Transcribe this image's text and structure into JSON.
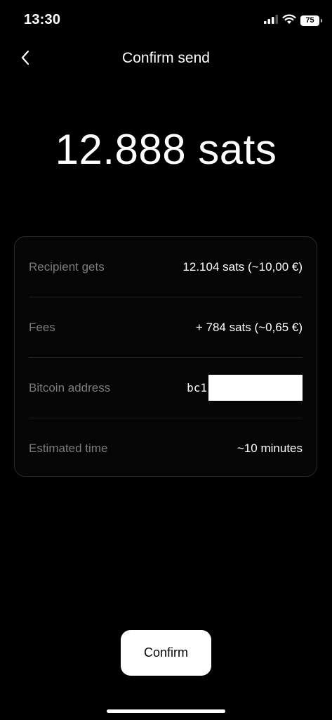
{
  "status_bar": {
    "time": "13:30",
    "battery": "75",
    "icons": [
      "cellular-signal-icon",
      "wifi-icon",
      "battery-icon"
    ]
  },
  "header": {
    "title": "Confirm send",
    "back_icon": "chevron-left-icon"
  },
  "amount": {
    "text": "12.888 sats"
  },
  "details": {
    "recipient_gets": {
      "label": "Recipient gets",
      "value": "12.104 sats (~10,00 €)"
    },
    "fees": {
      "label": "Fees",
      "value": "+ 784 sats (~0,65 €)"
    },
    "bitcoin_address": {
      "label": "Bitcoin address",
      "value_prefix": "bc1"
    },
    "estimated_time": {
      "label": "Estimated time",
      "value": "~10 minutes"
    }
  },
  "actions": {
    "confirm_label": "Confirm"
  },
  "colors": {
    "background": "#000000",
    "label_gray": "#7c7c7c",
    "card_border": "#2a2a2a",
    "button_bg": "#ffffff"
  }
}
